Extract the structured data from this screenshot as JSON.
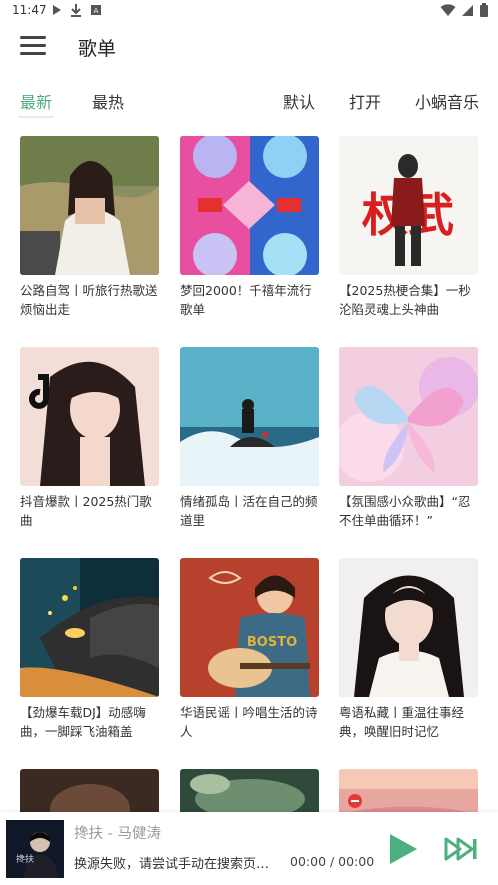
{
  "status_bar": {
    "time": "11:47"
  },
  "header": {
    "title": "歌单"
  },
  "tabs": [
    {
      "label": "最新",
      "active": true
    },
    {
      "label": "最热",
      "active": false
    }
  ],
  "actions": [
    {
      "label": "默认"
    },
    {
      "label": "打开"
    },
    {
      "label": "小蜗音乐"
    }
  ],
  "playlists": [
    {
      "title": "公路自驾丨听旅行热歌送烦恼出走"
    },
    {
      "title": "梦回2000！千禧年流行歌单"
    },
    {
      "title": "【2025热梗合集】一秒沦陷灵魂上头神曲",
      "cover_text": "权武"
    },
    {
      "title": "抖音爆款丨2025热门歌曲"
    },
    {
      "title": "情绪孤岛丨活在自己的频道里"
    },
    {
      "title": "【氛围感小众歌曲】“忍不住单曲循环！”"
    },
    {
      "title": "【劲爆车载DJ】动感嗨曲，一脚踩飞油箱盖"
    },
    {
      "title": "华语民谣丨吟唱生活的诗人",
      "cover_text": "BOSTO"
    },
    {
      "title": "粤语私藏丨重温往事经典，唤醒旧时记忆"
    }
  ],
  "player": {
    "song": "搀扶 - 马健涛",
    "status": "换源失败，请尝试手动在搜索页指定歌曲",
    "time": "00:00 / 00:00",
    "cover_text": "搀扶"
  },
  "colors": {
    "accent": "#4caf80"
  }
}
